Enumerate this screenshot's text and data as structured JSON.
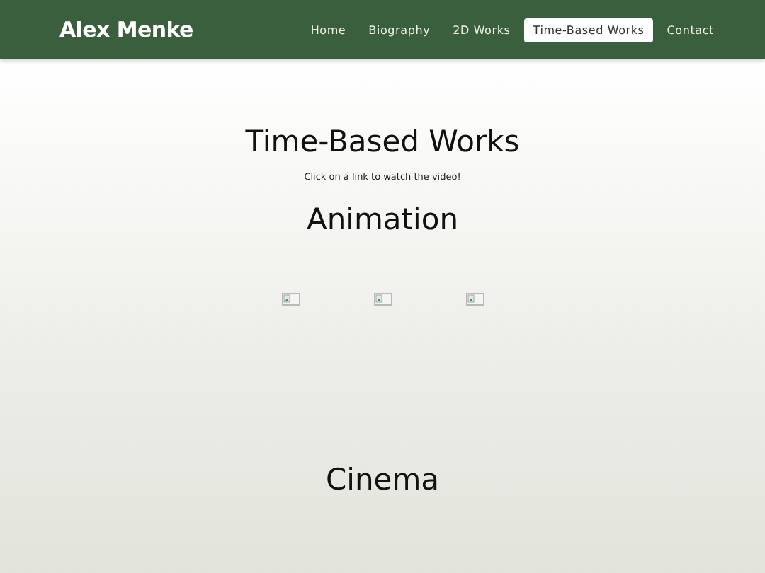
{
  "site_title": "Alex Menke",
  "nav": [
    {
      "label": "Home",
      "selected": false
    },
    {
      "label": "Biography",
      "selected": false
    },
    {
      "label": "2D Works",
      "selected": false
    },
    {
      "label": "Time-Based Works",
      "selected": true
    },
    {
      "label": "Contact",
      "selected": false
    }
  ],
  "heading": "Time-Based Works",
  "intro": "Click on a link to watch the video!",
  "sections": [
    {
      "title": "Animation",
      "videos": [
        {
          "kind": "broken-image"
        },
        {
          "kind": "broken-image"
        },
        {
          "kind": "broken-image"
        }
      ]
    },
    {
      "title": "Cinema"
    }
  ]
}
